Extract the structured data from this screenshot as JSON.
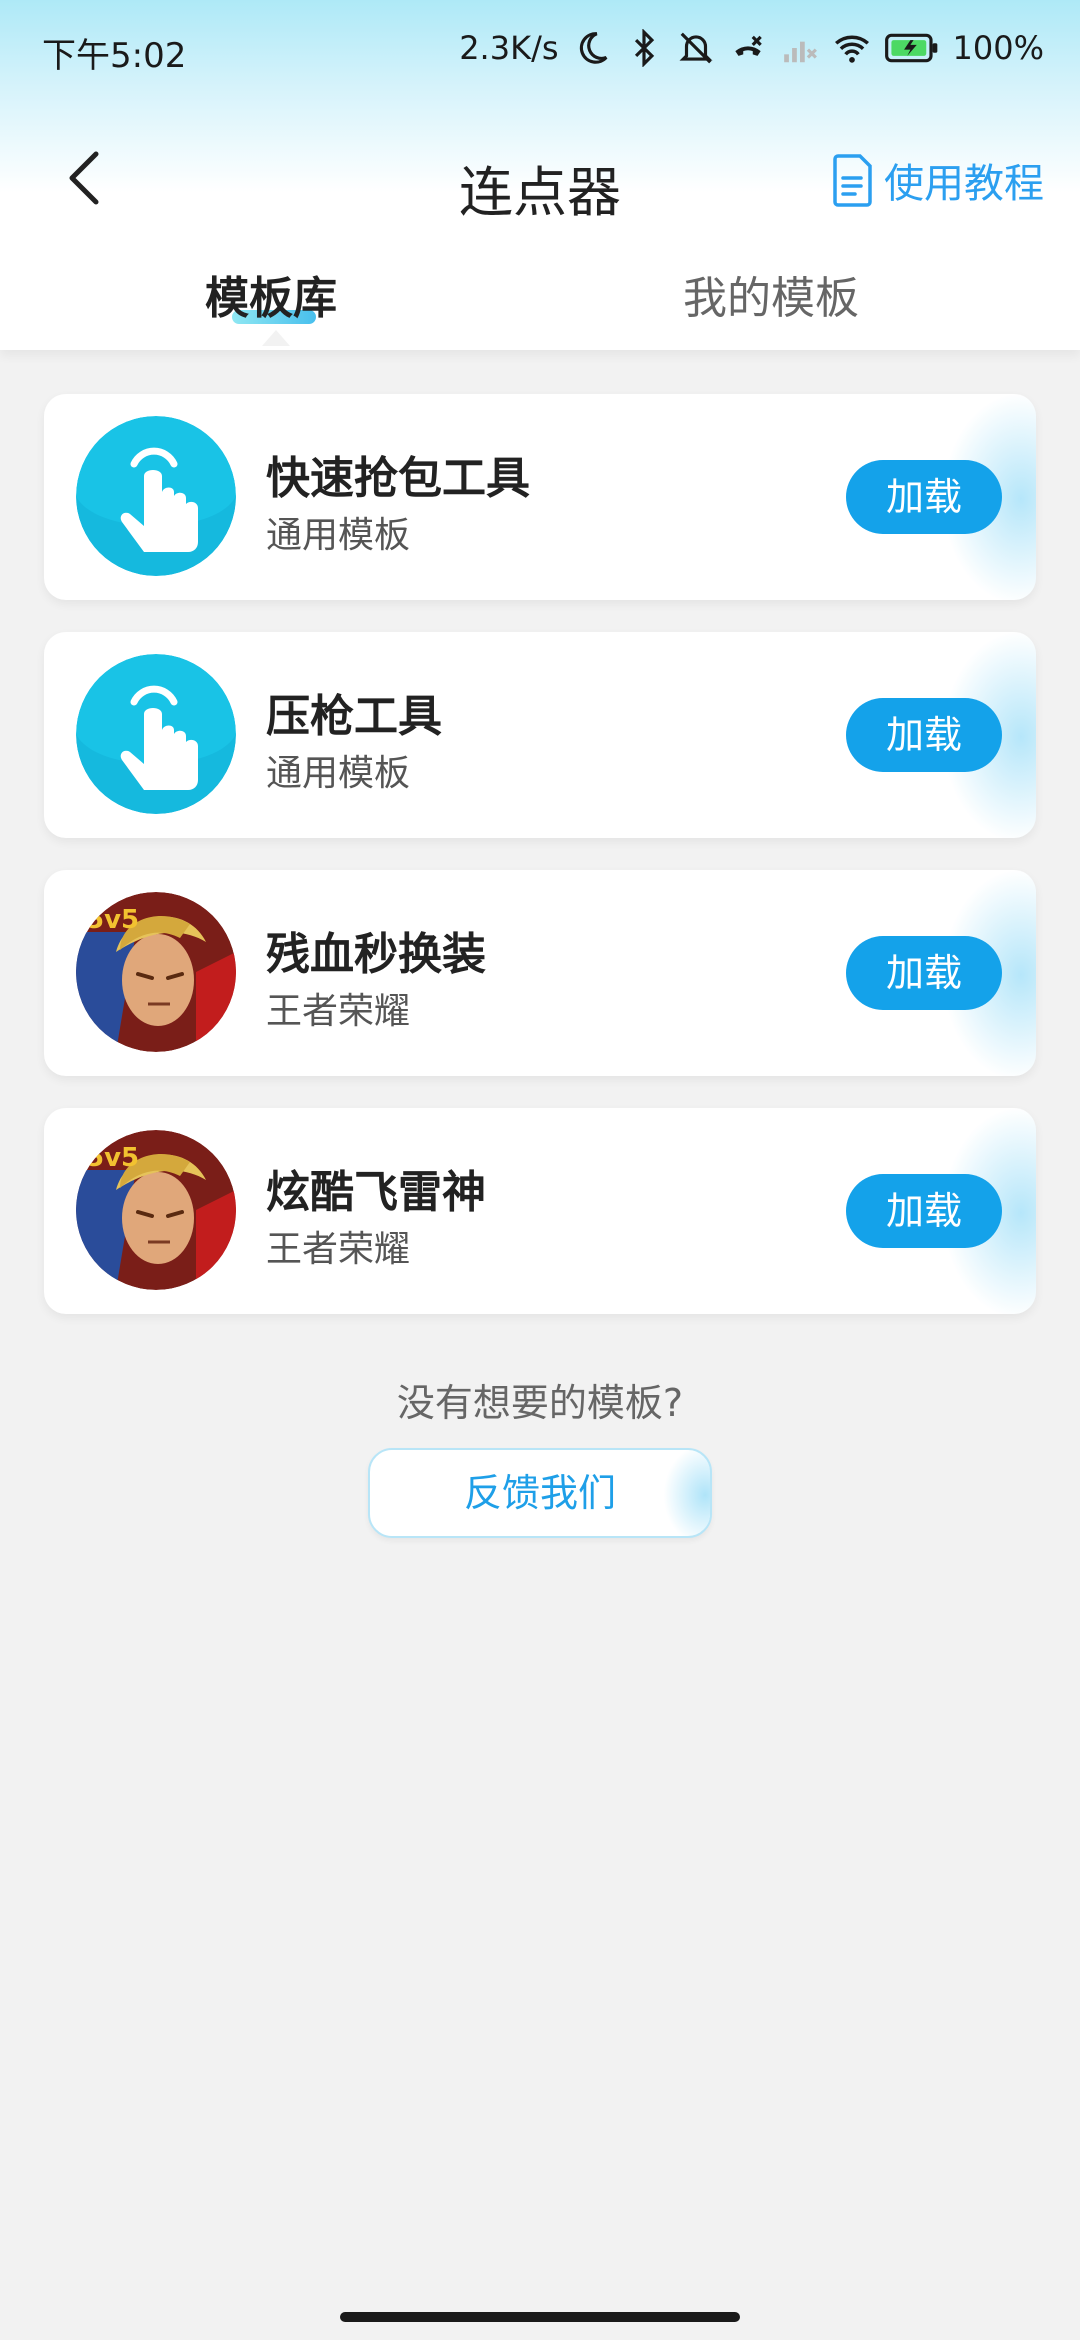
{
  "status_bar": {
    "time": "下午5:02",
    "speed": "2.3K/s",
    "battery": "100%",
    "icons": [
      "moon-icon",
      "bluetooth-icon",
      "mute-icon",
      "call-icon",
      "signal-icon",
      "wifi-icon",
      "battery-icon"
    ]
  },
  "nav": {
    "title": "连点器",
    "tutorial_label": "使用教程",
    "back_icon": "chevron-left-icon",
    "tutorial_icon": "document-icon"
  },
  "tabs": {
    "templates": "模板库",
    "mine": "我的模板",
    "active": "模板库"
  },
  "cards": [
    {
      "title": "快速抢包工具",
      "subtitle": "通用模板",
      "button": "加载",
      "icon": "tap-hand-icon"
    },
    {
      "title": "压枪工具",
      "subtitle": "通用模板",
      "button": "加载",
      "icon": "tap-hand-icon"
    },
    {
      "title": "残血秒换装",
      "subtitle": "王者荣耀",
      "button": "加载",
      "icon": "game-avatar-icon"
    },
    {
      "title": "炫酷飞雷神",
      "subtitle": "王者荣耀",
      "button": "加载",
      "icon": "game-avatar-icon"
    }
  ],
  "footer": {
    "prompt": "没有想要的模板?",
    "feedback_button": "反馈我们"
  },
  "colors": {
    "accent": "#14a2ea",
    "link": "#2b9ff0",
    "background": "#f2f2f2"
  }
}
